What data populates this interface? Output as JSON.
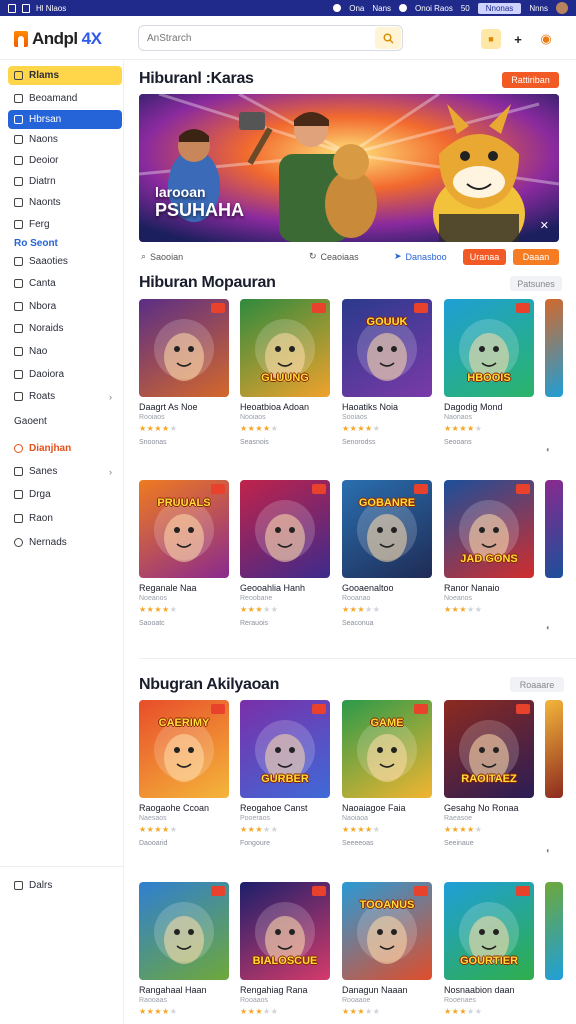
{
  "statusbar": {
    "left_label": "Hl Nlaos",
    "items": [
      "Ona",
      "Nans",
      "Onoi Raos",
      "50"
    ],
    "chip": "Nnonas",
    "right_label": "Nnns"
  },
  "app": {
    "logo_text": "Andpl",
    "logo_suffix": "4X"
  },
  "search": {
    "placeholder": "AnStrarch"
  },
  "sidebar": {
    "items": [
      {
        "label": "Rlams"
      },
      {
        "label": "Beoamand"
      },
      {
        "label": "Hbrsan"
      },
      {
        "label": "Naons"
      },
      {
        "label": "Deoior"
      },
      {
        "label": "Diatrn"
      },
      {
        "label": "Naonts"
      },
      {
        "label": "Ferg"
      },
      {
        "label": "Ro Seont"
      },
      {
        "label": "Saaoties"
      },
      {
        "label": "Canta"
      },
      {
        "label": "Nbora"
      },
      {
        "label": "Noraids"
      },
      {
        "label": "Nao"
      },
      {
        "label": "Daoiora"
      },
      {
        "label": "Roats"
      },
      {
        "label": "Gaoent"
      },
      {
        "label": "Dianjhan"
      },
      {
        "label": "Sanes"
      },
      {
        "label": "Drga"
      },
      {
        "label": "Raon"
      },
      {
        "label": "Nernads"
      }
    ],
    "footer_label": "Dalrs"
  },
  "hero_section": {
    "title": "Hiburanl :Karas",
    "button": "Rattiriban",
    "hero_line1": "larooan",
    "hero_line2": "PSUHAHA"
  },
  "meta": {
    "m1": "Saooian",
    "m2": "Ceaoiaas",
    "m3": "Danasboo",
    "btn1": "Uranaa",
    "btn2": "Daaan"
  },
  "section2": {
    "title": "Hiburan Mopauran",
    "see_all": "Patsunes",
    "cards": [
      {
        "title": "Daagrt As Noe",
        "sub": "Rooiaos",
        "rating": 4,
        "foot": "Snoonas",
        "label": "",
        "colors": [
          "#5a2e86",
          "#d4682b"
        ]
      },
      {
        "title": "Heoatbioa Adoan",
        "sub": "Nooiaos",
        "rating": 4,
        "foot": "Seasnois",
        "label": "GLUUNG",
        "colors": [
          "#2f8a3e",
          "#f0a22c"
        ]
      },
      {
        "title": "Haoatiks Noia",
        "sub": "Sooiaos",
        "rating": 4,
        "foot": "Senorodss",
        "label": "GOUUK",
        "colors": [
          "#2a3a8c",
          "#7a3aa8"
        ]
      },
      {
        "title": "Dagodig Mond",
        "sub": "Naonaos",
        "rating": 4,
        "foot": "Seooans",
        "label": "HBOOIS",
        "colors": [
          "#1e9fd6",
          "#2bb46a"
        ]
      }
    ]
  },
  "section2b": {
    "cards": [
      {
        "title": "Reganale Naa",
        "sub": "Noeanos",
        "rating": 4,
        "foot": "Saooatc",
        "label": "PRUUALS",
        "colors": [
          "#ef7b1f",
          "#8a2a8e"
        ]
      },
      {
        "title": "Geooahlia Hanh",
        "sub": "Reoobane",
        "rating": 3,
        "foot": "Rerauois",
        "label": "",
        "colors": [
          "#c0234a",
          "#3d2a8c"
        ]
      },
      {
        "title": "Gooaenaltoo",
        "sub": "Rooanao",
        "rating": 3,
        "foot": "Seaconua",
        "label": "GOBANRE",
        "colors": [
          "#2a6fb0",
          "#1f2b55"
        ]
      },
      {
        "title": "Ranor Nanaio",
        "sub": "Noeanos",
        "rating": 3,
        "foot": "",
        "label": "JAD GONS",
        "colors": [
          "#1b4f9a",
          "#d12d2d"
        ]
      }
    ]
  },
  "section3": {
    "title": "Nbugran Akilyaoan",
    "see_all": "Roaaare",
    "cards": [
      {
        "title": "Raogaohe Ccoan",
        "sub": "Naesaos",
        "rating": 4,
        "foot": "Daooarid",
        "label": "CAERIMY",
        "colors": [
          "#e84d2a",
          "#f4b63a"
        ]
      },
      {
        "title": "Reogahoe Canst",
        "sub": "Pooeraos",
        "rating": 3,
        "foot": "Fongoure",
        "label": "GURBER",
        "colors": [
          "#7a2fa8",
          "#3f6ad8"
        ]
      },
      {
        "title": "Naoaiagoe Faia",
        "sub": "Naoiaoa",
        "rating": 4,
        "foot": "Seeeeoas",
        "label": "GAME",
        "colors": [
          "#2c9a49",
          "#f2b531"
        ]
      },
      {
        "title": "Gesahg No Ronaa",
        "sub": "Raeasoe",
        "rating": 4,
        "foot": "Seeinaue",
        "label": "RAOITAEZ",
        "colors": [
          "#8d2a1f",
          "#2a1d55"
        ]
      }
    ]
  },
  "section3b": {
    "cards": [
      {
        "title": "Rangahaal Haan",
        "sub": "Raooaas",
        "rating": 4,
        "foot": "",
        "label": "",
        "colors": [
          "#2f7fd1",
          "#6fa83a"
        ]
      },
      {
        "title": "Rengahiag Rana",
        "sub": "Rooaaos",
        "rating": 3,
        "foot": "",
        "label": "BIALOSCUE",
        "colors": [
          "#1c1f6b",
          "#d43b6a"
        ]
      },
      {
        "title": "Danagun Naaan",
        "sub": "Rooaaoe",
        "rating": 3,
        "foot": "",
        "label": "TOOANUS",
        "colors": [
          "#2a9ad6",
          "#e04d2a"
        ]
      },
      {
        "title": "Nosnaabion daan",
        "sub": "Rooenaes",
        "rating": 3,
        "foot": "",
        "label": "GOURTIER",
        "colors": [
          "#1f9fd9",
          "#2fae4a"
        ]
      }
    ]
  },
  "colors": {
    "accent_orange": "#f15a24",
    "accent_blue": "#2563d8",
    "accent_yellow": "#ffd64a"
  }
}
